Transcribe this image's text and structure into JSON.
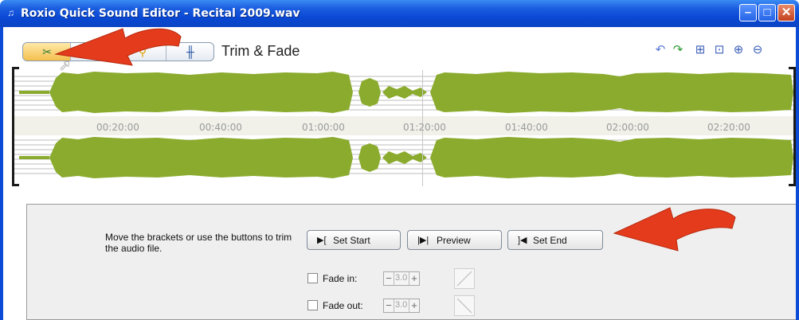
{
  "window": {
    "title": "Roxio Quick Sound Editor - Recital 2009.wav",
    "icon": "headphones-icon",
    "controls": [
      "minimize-icon",
      "maximize-icon",
      "close-icon"
    ]
  },
  "toolbar": {
    "mode_title": "Trim & Fade",
    "segments": [
      {
        "name": "trim-tool",
        "icon": "trim-icon",
        "active": true
      },
      {
        "name": "blank-tool",
        "icon": "none",
        "active": false
      },
      {
        "name": "effect-tool",
        "icon": "magic-wand-icon",
        "active": false
      },
      {
        "name": "mixer-tool",
        "icon": "equalizer-icon",
        "active": false
      }
    ],
    "right_icons": [
      "undo-icon",
      "redo-icon",
      "zoom-selection-icon",
      "zoom-fit-icon",
      "zoom-in-icon",
      "zoom-out-icon"
    ]
  },
  "timeline": {
    "ticks": [
      "00:20:00",
      "00:40:00",
      "01:00:00",
      "01:20:00",
      "01:40:00",
      "02:00:00",
      "02:20:00"
    ]
  },
  "panel": {
    "instructions": "Move the brackets or use the buttons to trim the audio file.",
    "set_start": "Set Start",
    "preview": "Preview",
    "set_end": "Set End",
    "fade_in_label": "Fade in:",
    "fade_out_label": "Fade out:",
    "fade_in_value": "3.0",
    "fade_out_value": "3.0"
  },
  "colors": {
    "waveform": "#8aab2d",
    "annotation_arrow": "#e43b1c",
    "titlebar": "#0a48d4"
  }
}
